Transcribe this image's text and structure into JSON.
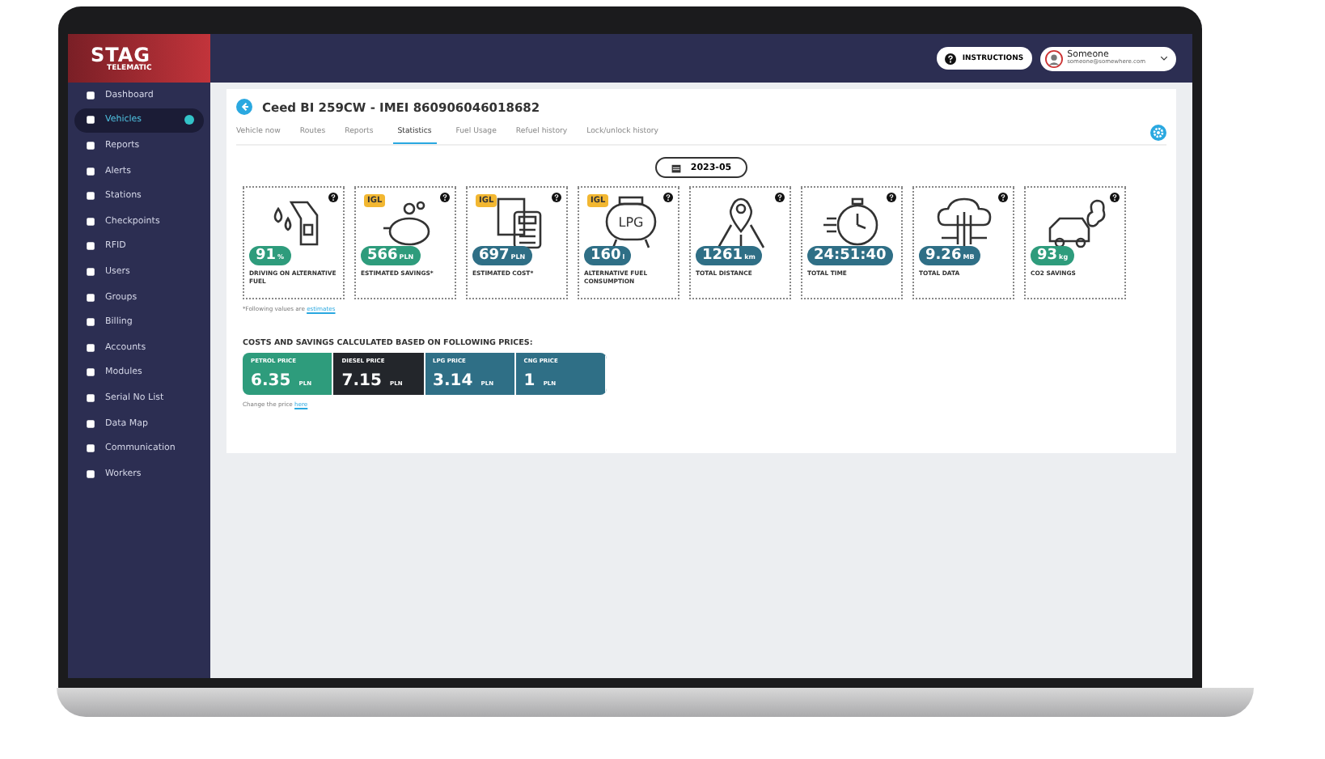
{
  "logo": {
    "name": "STAG",
    "sub": "TELEMATIC"
  },
  "sidebar": {
    "items": [
      {
        "label": "Dashboard",
        "selected": false
      },
      {
        "label": "Vehicles",
        "selected": true
      },
      {
        "label": "Reports",
        "selected": false
      },
      {
        "label": "Alerts",
        "selected": false
      },
      {
        "label": "Stations",
        "selected": false
      },
      {
        "label": "Checkpoints",
        "selected": false
      },
      {
        "label": "RFID",
        "selected": false
      },
      {
        "label": "Users",
        "selected": false
      },
      {
        "label": "Groups",
        "selected": false
      },
      {
        "label": "Billing",
        "selected": false
      },
      {
        "label": "Accounts",
        "selected": false
      },
      {
        "label": "Modules",
        "selected": false
      },
      {
        "label": "Serial No List",
        "selected": false
      },
      {
        "label": "Data Map",
        "selected": false
      },
      {
        "label": "Communication",
        "selected": false
      },
      {
        "label": "Workers",
        "selected": false
      }
    ]
  },
  "topbar": {
    "instructions": "INSTRUCTIONS",
    "user_name": "Someone",
    "user_email": "someone@somewhere.com"
  },
  "vehicle": {
    "title": "Ceed BI 259CW - IMEI 860906046018682"
  },
  "tabs": [
    {
      "label": "Vehicle now",
      "selected": false
    },
    {
      "label": "Routes",
      "selected": false
    },
    {
      "label": "Reports",
      "selected": false
    },
    {
      "label": "Statistics",
      "selected": true
    },
    {
      "label": "Fuel Usage",
      "selected": false
    },
    {
      "label": "Refuel history",
      "selected": false
    },
    {
      "label": "Lock/unlock history",
      "selected": false
    }
  ],
  "period": "2023-05",
  "tiles": [
    {
      "value": "91",
      "unit": "%",
      "label": "DRIVING ON ALTERNATIVE FUEL",
      "color": "#2e9c7c"
    },
    {
      "badge": "IGL",
      "value": "566",
      "unit": "PLN",
      "label": "ESTIMATED SAVINGS*",
      "color": "#2e9c7c"
    },
    {
      "badge": "IGL",
      "value": "697",
      "unit": "PLN",
      "label": "ESTIMATED COST*",
      "color": "#2f6f86"
    },
    {
      "badge": "IGL",
      "icon_text": "LPG",
      "value": "160",
      "unit": "l",
      "label": "ALTERNATIVE FUEL CONSUMPTION",
      "color": "#2f6f86"
    },
    {
      "value": "1261",
      "unit": "km",
      "label": "TOTAL DISTANCE",
      "color": "#2f6f86"
    },
    {
      "value": "24:51:40",
      "label": "TOTAL TIME",
      "color": "#2f6f86"
    },
    {
      "value": "9.26",
      "unit": "MB",
      "label": "TOTAL DATA",
      "color": "#2f6f86"
    },
    {
      "value": "93",
      "unit": "kg",
      "label": "CO2 SAVINGS",
      "color": "#2e9c7c"
    }
  ],
  "footnote": {
    "text": "*Following values are",
    "link": "estimates"
  },
  "prices": {
    "heading": "COSTS AND SAVINGS CALCULATED BASED ON FOLLOWING PRICES:",
    "items": [
      {
        "label": "PETROL PRICE",
        "value": "6.35",
        "unit": "PLN",
        "color": "#2e9c7c"
      },
      {
        "label": "DIESEL PRICE",
        "value": "7.15",
        "unit": "PLN",
        "color": "#23262b"
      },
      {
        "label": "LPG PRICE",
        "value": "3.14",
        "unit": "PLN",
        "color": "#2f6f86"
      },
      {
        "label": "CNG PRICE",
        "value": "1",
        "unit": "PLN",
        "color": "#2f6f86"
      }
    ],
    "change_text": "Change the price",
    "change_link": "here"
  }
}
